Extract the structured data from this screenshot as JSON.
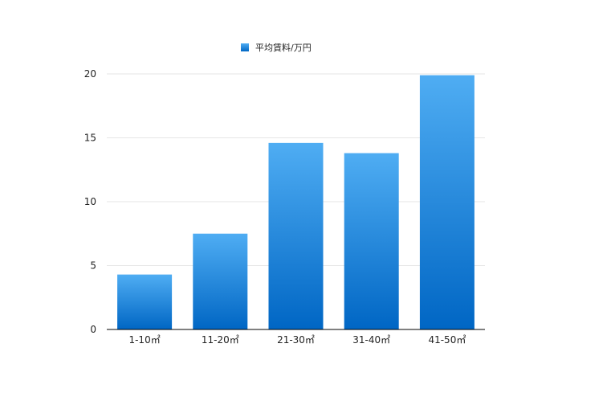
{
  "chart_data": {
    "type": "bar",
    "categories": [
      "1-10㎡",
      "11-20㎡",
      "21-30㎡",
      "31-40㎡",
      "41-50㎡"
    ],
    "series": [
      {
        "name": "平均賃料/万円",
        "values": [
          4.3,
          7.5,
          14.6,
          13.8,
          19.9
        ]
      }
    ],
    "ylim": [
      0,
      20
    ],
    "yticks": [
      0,
      5,
      10,
      15,
      20
    ],
    "grid": true,
    "legend": "top-center",
    "colors": {
      "bar_top": "#4fadf3",
      "bar_bottom": "#0066c4",
      "gridline": "#e6e6e6",
      "axis": "#000000"
    }
  }
}
